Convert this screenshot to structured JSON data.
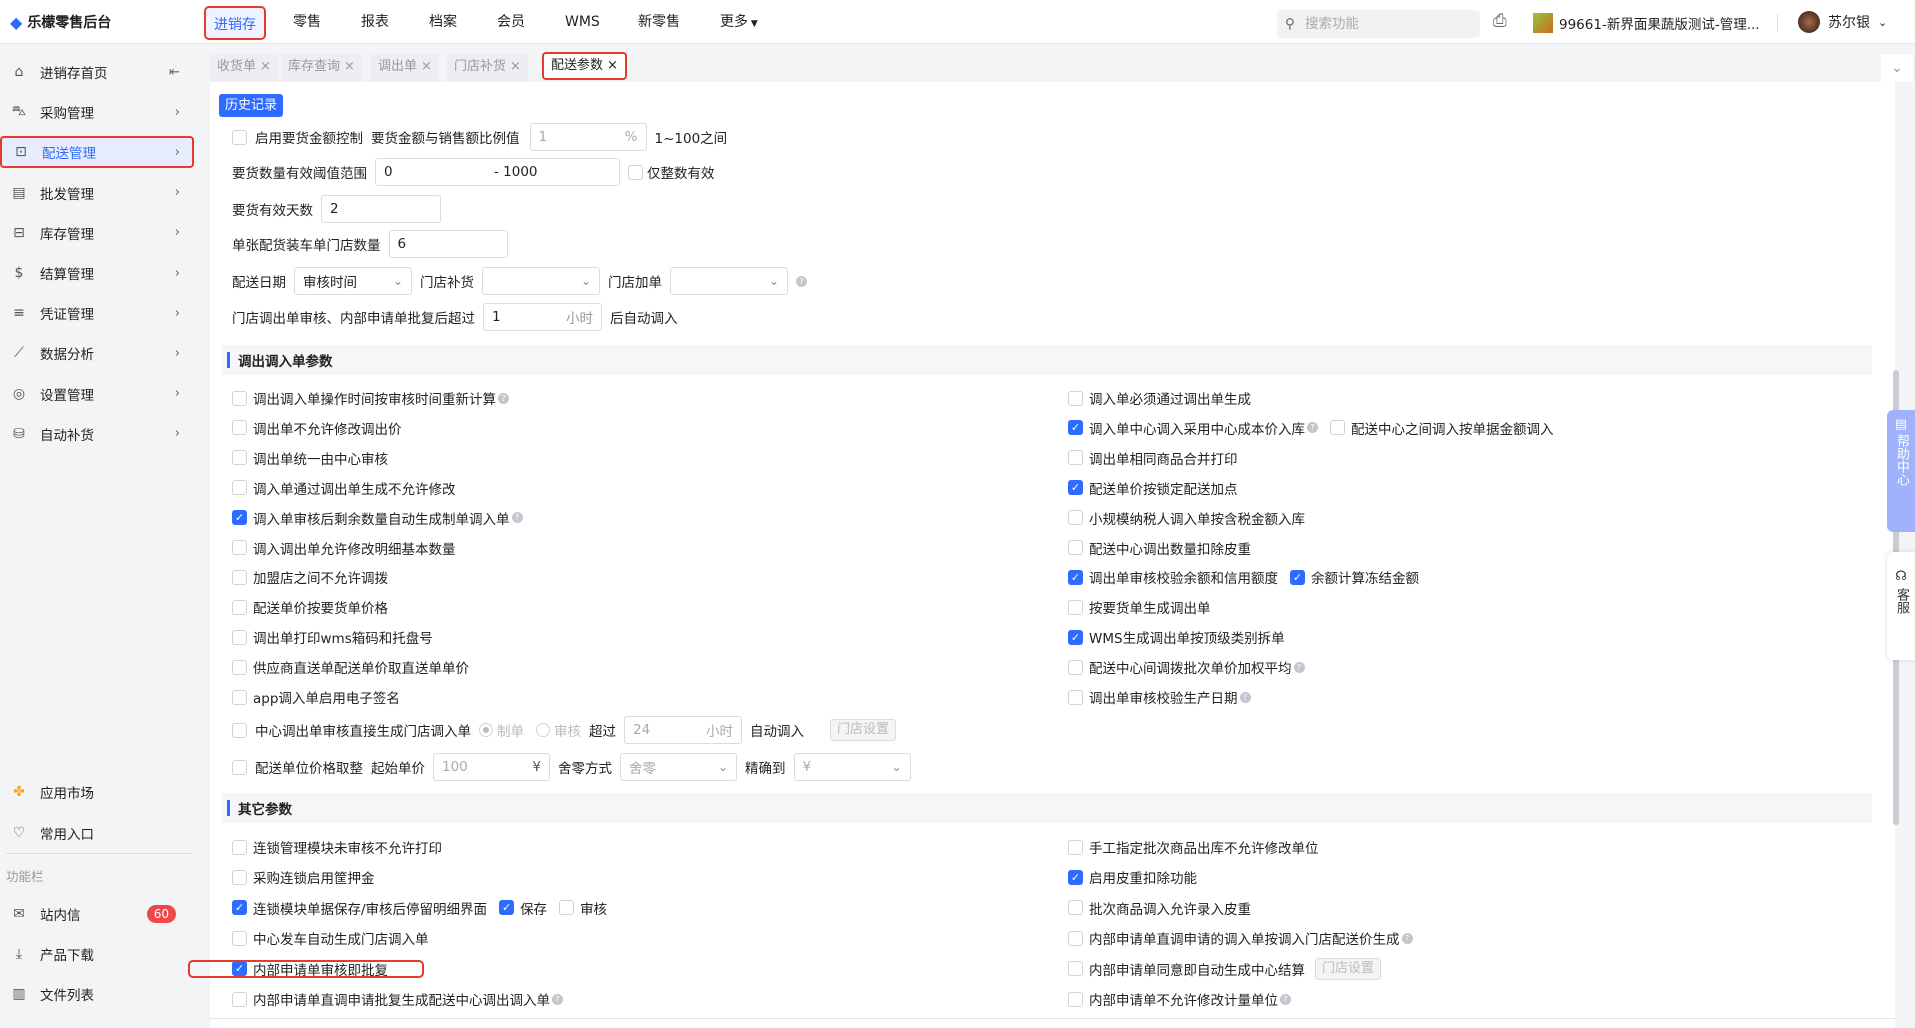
{
  "app": {
    "logo_icon": "diamond-logo-icon",
    "title": "乐檬零售后台"
  },
  "topnav": [
    "进销存",
    "零售",
    "报表",
    "档案",
    "会员",
    "WMS",
    "新零售",
    "更多"
  ],
  "search": {
    "placeholder": "搜索功能"
  },
  "store": "99661-新界面果蔬版测试-管理...",
  "user": "苏尔银",
  "sidebar": {
    "items": [
      {
        "label": "进销存首页",
        "icon": "home-icon"
      },
      {
        "label": "采购管理",
        "icon": "cart-icon"
      },
      {
        "label": "配送管理",
        "icon": "delivery-icon"
      },
      {
        "label": "批发管理",
        "icon": "wholesale-icon"
      },
      {
        "label": "库存管理",
        "icon": "inventory-icon"
      },
      {
        "label": "结算管理",
        "icon": "settlement-icon"
      },
      {
        "label": "凭证管理",
        "icon": "voucher-icon"
      },
      {
        "label": "数据分析",
        "icon": "chart-icon"
      },
      {
        "label": "设置管理",
        "icon": "settings-icon"
      },
      {
        "label": "自动补货",
        "icon": "replenish-icon"
      }
    ],
    "app_market": "应用市场",
    "favorites": "常用入口",
    "group_label": "功能栏",
    "messages": "站内信",
    "messages_badge": "60",
    "downloads": "产品下载",
    "files": "文件列表"
  },
  "tabs": [
    "收货单",
    "库存查询",
    "调出单",
    "门店补货",
    "配送参数"
  ],
  "history_button": "历史记录",
  "form": {
    "amount_control": {
      "label": "启用要货金额控制",
      "checked": false,
      "ratio_label": "要货金额与销售额比例值",
      "ratio_value": "1",
      "ratio_unit": "%",
      "range_hint": "1~100之间"
    },
    "qty_range": {
      "label": "要货数量有效阈值范围",
      "min": "0",
      "max": "- 1000",
      "integer_label": "仅整数有效",
      "integer_checked": false
    },
    "valid_days": {
      "label": "要货有效天数",
      "value": "2"
    },
    "stores_per_truck": {
      "label": "单张配货装车单门店数量",
      "value": "6"
    },
    "delivery_date": {
      "label": "配送日期",
      "value": "审核时间",
      "replenish_label": "门店补货",
      "replenish_value": "",
      "addorder_label": "门店加单",
      "addorder_value": ""
    },
    "auto_transfer": {
      "label": "门店调出单审核、内部申请单批复后超过",
      "value": "1",
      "unit": "小时",
      "suffix": "后自动调入"
    }
  },
  "section1": {
    "title": "调出调入单参数",
    "left": [
      {
        "label": "调出调入单操作时间按审核时间重新计算",
        "checked": false,
        "help": true
      },
      {
        "label": "调出单不允许修改调出价",
        "checked": false
      },
      {
        "label": "调出单统一由中心审核",
        "checked": false
      },
      {
        "label": "调入单通过调出单生成不允许修改",
        "checked": false
      },
      {
        "label": "调入单审核后剩余数量自动生成制单调入单",
        "checked": true,
        "help": true
      },
      {
        "label": "调入调出单允许修改明细基本数量",
        "checked": false
      },
      {
        "label": "加盟店之间不允许调拨",
        "checked": false
      },
      {
        "label": "配送单价按要货单价格",
        "checked": false
      },
      {
        "label": "调出单打印wms箱码和托盘号",
        "checked": false
      },
      {
        "label": "供应商直送单配送单价取直送单单价",
        "checked": false
      },
      {
        "label": "app调入单启用电子签名",
        "checked": false
      }
    ],
    "right": [
      {
        "label": "调入单必须通过调出单生成",
        "checked": false
      },
      {
        "label": "调入单中心调入采用中心成本价入库",
        "checked": true,
        "help": true,
        "extra": [
          {
            "label": "配送中心之间调入按单据金额调入",
            "checked": false
          }
        ]
      },
      {
        "label": "调出单相同商品合并打印",
        "checked": false
      },
      {
        "label": "配送单价按锁定配送加点",
        "checked": true
      },
      {
        "label": "小规模纳税人调入单按含税金额入库",
        "checked": false
      },
      {
        "label": "配送中心调出数量扣除皮重",
        "checked": false
      },
      {
        "label": "调出单审核校验余额和信用额度",
        "checked": true,
        "extra": [
          {
            "label": "余额计算冻结金额",
            "checked": true
          }
        ]
      },
      {
        "label": "按要货单生成调出单",
        "checked": false
      },
      {
        "label": "WMS生成调出单按顶级类别拆单",
        "checked": true
      },
      {
        "label": "配送中心间调拨批次单价加权平均",
        "checked": false,
        "help": true
      },
      {
        "label": "调出单审核校验生产日期",
        "checked": false,
        "help": true
      }
    ],
    "center_auto": {
      "label": "中心调出单审核直接生成门店调入单",
      "checked": false,
      "radio1": "制单",
      "radio2": "审核",
      "over": "超过",
      "hours": "24",
      "unit": "小时",
      "suffix": "自动调入",
      "store_settings": "门店设置"
    },
    "rounding": {
      "label": "配送单位价格取整",
      "checked": false,
      "start_label": "起始单价",
      "start_value": "100",
      "currency": "¥",
      "mode_label": "舍零方式",
      "mode_value": "舍零",
      "precision_label": "精确到",
      "precision_value": "¥"
    }
  },
  "section2": {
    "title": "其它参数",
    "left": [
      {
        "label": "连锁管理模块未审核不允许打印",
        "checked": false
      },
      {
        "label": "采购连锁启用筐押金",
        "checked": false
      },
      {
        "label": "连锁模块单据保存/审核后停留明细界面",
        "checked": true,
        "extra": [
          {
            "label": "保存",
            "checked": true
          },
          {
            "label": "审核",
            "checked": false
          }
        ]
      },
      {
        "label": "中心发车自动生成门店调入单",
        "checked": false
      },
      {
        "label": "内部申请单审核即批复",
        "checked": true
      },
      {
        "label": "内部申请单直调申请批复生成配送中心调出调入单",
        "checked": false,
        "help": true
      }
    ],
    "right": [
      {
        "label": "手工指定批次商品出库不允许修改单位",
        "checked": false
      },
      {
        "label": "启用皮重扣除功能",
        "checked": true
      },
      {
        "label": "批次商品调入允许录入皮重",
        "checked": false
      },
      {
        "label": "内部申请单直调申请的调入单按调入门店配送价生成",
        "checked": false,
        "help": true
      },
      {
        "label": "内部申请单同意即自动生成中心结算",
        "checked": false,
        "button": "门店设置"
      },
      {
        "label": "内部申请单不允许修改计量单位",
        "checked": false,
        "help": true
      }
    ]
  },
  "float": {
    "help_center": "帮助中心",
    "customer_service": "客服"
  },
  "colors": {
    "accent": "#2f6bff",
    "highlight": "#e53b2c",
    "badge": "#f04848"
  }
}
